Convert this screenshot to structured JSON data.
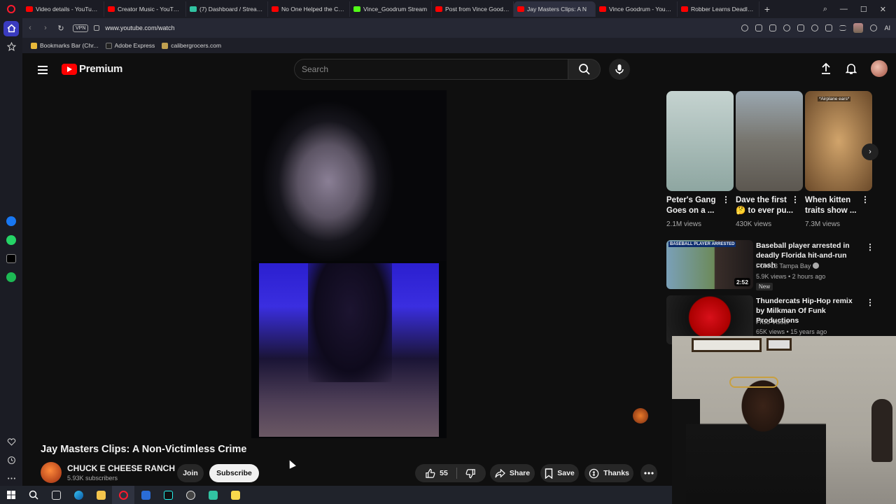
{
  "browser": {
    "tabs": [
      {
        "title": "Video details - YouTube Studio",
        "color": "#ff0000"
      },
      {
        "title": "Creator Music - YouTube Studio",
        "color": "#ff0000"
      },
      {
        "title": "(7) Dashboard / Streamlabs",
        "color": "#31c3a2"
      },
      {
        "title": "No One Helped the Cop?",
        "color": "#ff0000"
      },
      {
        "title": "Vince_Goodrum Stream",
        "color": "#53fc18"
      },
      {
        "title": "Post from Vince Goodrum",
        "color": "#ff0000"
      },
      {
        "title": "Jay Masters Clips: A N",
        "color": "#ff0000",
        "active": true
      },
      {
        "title": "Vince Goodrum - YouTube",
        "color": "#ff0000"
      },
      {
        "title": "Robber Learns Deadly Les",
        "color": "#ff0000"
      }
    ],
    "new_tab": "+",
    "url": "www.youtube.com/watch",
    "vpn_label": "VPN",
    "ai_label": "AI",
    "bookmarks": [
      {
        "label": "Bookmarks Bar (Chr...",
        "color": "#e8b83a"
      },
      {
        "label": "Adobe Express",
        "color": "#222"
      },
      {
        "label": "calibergrocers.com",
        "color": "#c0a050"
      }
    ]
  },
  "youtube": {
    "logo_word": "Premium",
    "search_placeholder": "Search",
    "video": {
      "title": "Jay Masters Clips: A Non-Victimless Crime",
      "channel": "CHUCK E CHEESE RANCH",
      "subscribers": "5.93K subscribers",
      "join_label": "Join",
      "subscribe_label": "Subscribe",
      "likes": "55",
      "share_label": "Share",
      "save_label": "Save",
      "thanks_label": "Thanks"
    },
    "shorts": [
      {
        "title": "Peter's Gang Goes on a ...",
        "views": "2.1M views",
        "thumb": "#b9c7c4"
      },
      {
        "title": "Dave the first 🤔 to ever pu...",
        "views": "430K views",
        "thumb": "#8d8a84"
      },
      {
        "title": "When kitten traits show ...",
        "views": "7.3M views",
        "thumb": "#a98a62",
        "overlay": "*Airplane ears*"
      }
    ],
    "recommended": [
      {
        "title": "Baseball player arrested in deadly Florida hit-and-run crash",
        "channel": "FOX 13 Tampa Bay",
        "meta": "5.9K views • 2 hours ago",
        "badge": "New",
        "duration": "2:52",
        "thumb_label": "BASEBALL PLAYER ARRESTED"
      },
      {
        "title": "Thundercats Hip-Hop remix by Milkman Of Funk Productions",
        "channel": "Friso Visser",
        "meta": "65K views • 15 years ago"
      }
    ]
  }
}
